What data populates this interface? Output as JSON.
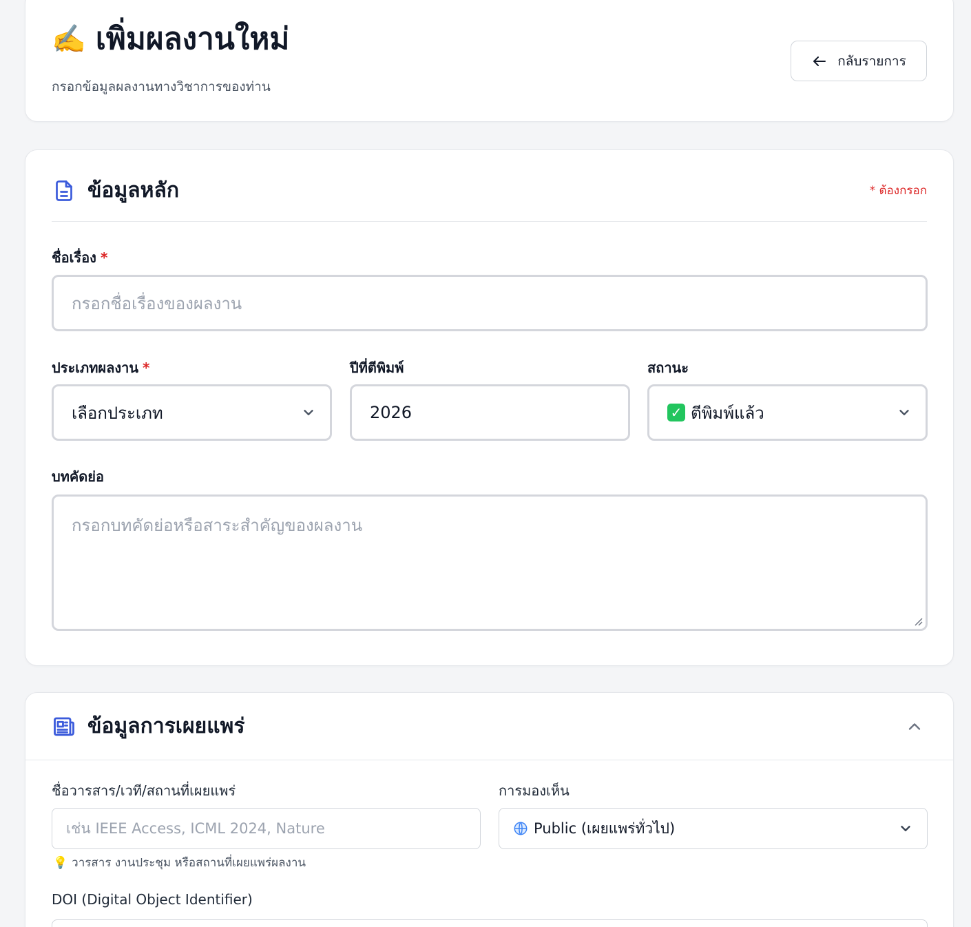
{
  "header": {
    "emoji": "✍️",
    "title": "เพิ่มผลงานใหม่",
    "subtitle": "กรอกข้อมูลผลงานทางวิชาการของท่าน",
    "back_label": "กลับรายการ"
  },
  "main_section": {
    "title": "ข้อมูลหลัก",
    "required_note": "* ต้องกรอก",
    "title_field": {
      "label": "ชื่อเรื่อง",
      "required": "*",
      "placeholder": "กรอกชื่อเรื่องของผลงาน",
      "value": ""
    },
    "type_field": {
      "label": "ประเภทผลงาน",
      "required": "*",
      "selected": "เลือกประเภท"
    },
    "year_field": {
      "label": "ปีที่ตีพิมพ์",
      "value": "2026"
    },
    "status_field": {
      "label": "สถานะ",
      "check": "✓",
      "selected": "ตีพิมพ์แล้ว"
    },
    "abstract_field": {
      "label": "บทคัดย่อ",
      "placeholder": "กรอกบทคัดย่อหรือสาระสำคัญของผลงาน"
    }
  },
  "publication_section": {
    "title": "ข้อมูลการเผยแพร่",
    "venue_field": {
      "label": "ชื่อวารสาร/เวที/สถานที่เผยแพร่",
      "placeholder": "เช่น IEEE Access, ICML 2024, Nature",
      "hint_icon": "💡",
      "hint": "วารสาร งานประชุม หรือสถานที่เผยแพร่ผลงาน"
    },
    "visibility_field": {
      "label": "การมองเห็น",
      "selected": "Public (เผยแพร่ทั่วไป)"
    },
    "doi_field": {
      "label": "DOI (Digital Object Identifier)"
    }
  },
  "colors": {
    "accent": "#3b5bdb",
    "required": "#dc2626",
    "success": "#22c55e"
  },
  "icons": {
    "back": "arrow-left-icon",
    "main_section": "document-icon",
    "publication_section": "newspaper-icon",
    "collapse": "chevron-up-icon",
    "select": "chevron-down-icon",
    "visibility": "globe-icon"
  }
}
